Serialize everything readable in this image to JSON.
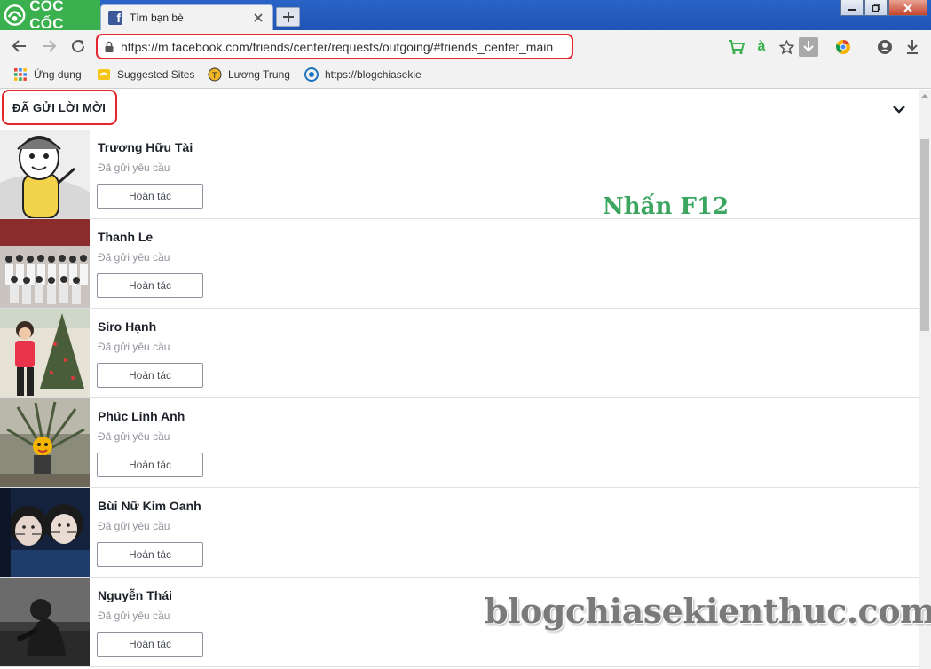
{
  "browser": {
    "brand": "CỐC CỐC",
    "tab": {
      "title": "Tìm bạn bè"
    },
    "url": "https://m.facebook.com/friends/center/requests/outgoing/#friends_center_main",
    "translate_icon": "à"
  },
  "bookmarks": [
    {
      "label": "Ứng dụng",
      "icon": "apps-grid-icon"
    },
    {
      "label": "Suggested Sites",
      "icon": "suggested-sites-icon"
    },
    {
      "label": "Lương Trung",
      "icon": "user-favicon-icon"
    },
    {
      "label": "https://blogchiasekie",
      "icon": "blog-favicon-icon"
    }
  ],
  "section": {
    "title": "ĐÃ GỬI LỜI MỜI"
  },
  "requests": [
    {
      "name": "Trương Hữu Tài",
      "status": "Đã gửi yêu cầu",
      "button": "Hoàn tác"
    },
    {
      "name": "Thanh Le",
      "status": "Đã gửi yêu cầu",
      "button": "Hoàn tác"
    },
    {
      "name": "Siro Hạnh",
      "status": "Đã gửi yêu cầu",
      "button": "Hoàn tác"
    },
    {
      "name": "Phúc Linh Anh",
      "status": "Đã gửi yêu cầu",
      "button": "Hoàn tác"
    },
    {
      "name": "Bùi Nữ Kim Oanh",
      "status": "Đã gửi yêu cầu",
      "button": "Hoàn tác"
    },
    {
      "name": "Nguyễn Thái",
      "status": "Đã gửi yêu cầu",
      "button": "Hoàn tác"
    }
  ],
  "overlay": {
    "hint": "Nhấn F12",
    "watermark": "blogchiasekienthuc.com"
  },
  "colors": {
    "brand_green": "#3bb04e",
    "highlight_red": "#e5262d",
    "hint_green": "#3aa660",
    "facebook_blue": "#3b5998"
  }
}
